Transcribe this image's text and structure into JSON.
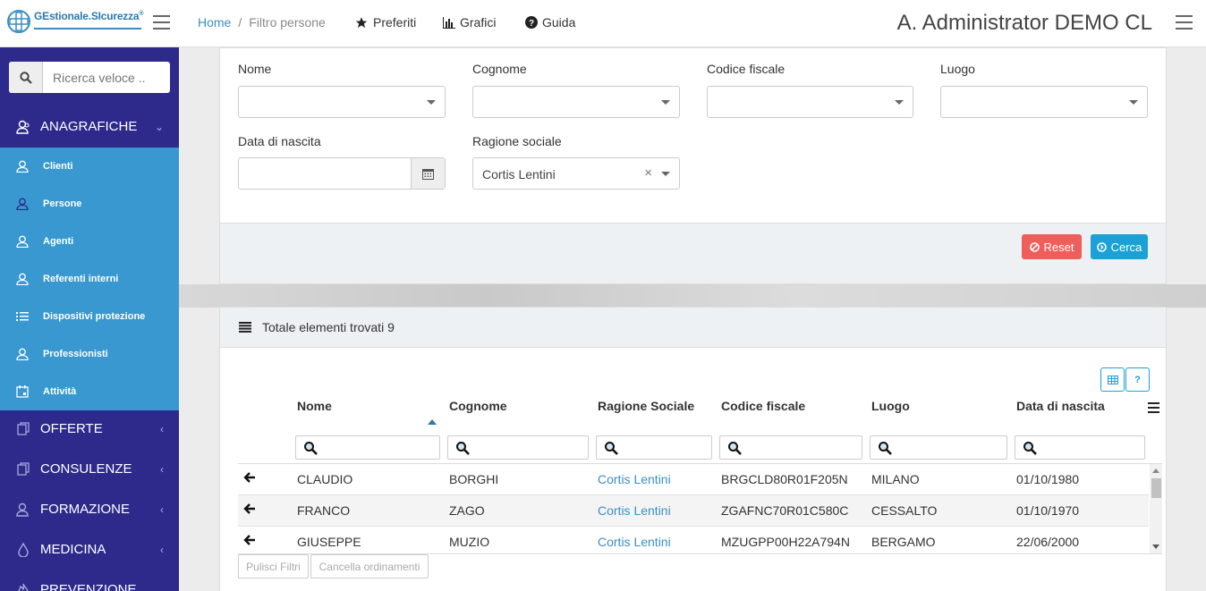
{
  "header": {
    "logo_text": "GEstionale.SIcurezza",
    "logo_mark": "®",
    "breadcrumb": {
      "home": "Home",
      "separator": "/",
      "current": "Filtro persone"
    },
    "nav": [
      {
        "label": "Preferiti",
        "icon": "star-icon"
      },
      {
        "label": "Grafici",
        "icon": "bar-chart-icon"
      },
      {
        "label": "Guida",
        "icon": "question-circle-icon"
      }
    ],
    "user": "A. Administrator DEMO CL"
  },
  "sidebar": {
    "search_placeholder": "Ricerca veloce ..",
    "sections": [
      {
        "label": "ANAGRAFICHE",
        "icon": "users-outline-icon",
        "expanded": true
      },
      {
        "label": "OFFERTE",
        "icon": "copy-icon"
      },
      {
        "label": "CONSULENZE",
        "icon": "copy-icon"
      },
      {
        "label": "FORMAZIONE",
        "icon": "users-outline-icon"
      },
      {
        "label": "MEDICINA",
        "icon": "drop-icon"
      },
      {
        "label": "PREVENZIONE",
        "icon": "fire-icon"
      }
    ],
    "subitems": [
      {
        "label": "Clienti",
        "icon": "user-icon"
      },
      {
        "label": "Persone",
        "icon": "user-icon",
        "active": true
      },
      {
        "label": "Agenti",
        "icon": "user-icon"
      },
      {
        "label": "Referenti interni",
        "icon": "user-icon"
      },
      {
        "label": "Dispositivi protezione",
        "icon": "list-icon"
      },
      {
        "label": "Professionisti",
        "icon": "user-icon"
      },
      {
        "label": "Attività",
        "icon": "calendar-icon"
      }
    ]
  },
  "filters": {
    "nome": {
      "label": "Nome",
      "value": ""
    },
    "cognome": {
      "label": "Cognome",
      "value": ""
    },
    "codice_fiscale": {
      "label": "Codice fiscale",
      "value": ""
    },
    "luogo": {
      "label": "Luogo",
      "value": ""
    },
    "data_nascita": {
      "label": "Data di nascita",
      "value": ""
    },
    "ragione_sociale": {
      "label": "Ragione sociale",
      "value": "Cortis Lentini",
      "clear": "×"
    },
    "reset_label": "Reset",
    "search_label": "Cerca"
  },
  "results": {
    "title": "Totale elementi trovati 9",
    "tool_help": "?",
    "columns": [
      "Nome",
      "Cognome",
      "Ragione Sociale",
      "Codice fiscale",
      "Luogo",
      "Data di nascita"
    ],
    "rows": [
      [
        "CLAUDIO",
        "BORGHI",
        "Cortis Lentini",
        "BRGCLD80R01F205N",
        "MILANO",
        "01/10/1980"
      ],
      [
        "FRANCO",
        "ZAGO",
        "Cortis Lentini",
        "ZGAFNC70R01C580C",
        "CESSALTO",
        "01/10/1970"
      ],
      [
        "GIUSEPPE",
        "MUZIO",
        "Cortis Lentini",
        "MZUGPP00H22A794N",
        "BERGAMO",
        "22/06/2000"
      ]
    ],
    "clear_filters_label": "Pulisci Filtri",
    "clear_sort_label": "Cancella ordinamenti"
  },
  "colors": {
    "sidebar_bg": "#2d2a8c",
    "submenu_bg": "#3898cf",
    "link": "#3b8fc4",
    "reset_btn": "#ee5f5b",
    "search_btn": "#1ca1d6"
  }
}
